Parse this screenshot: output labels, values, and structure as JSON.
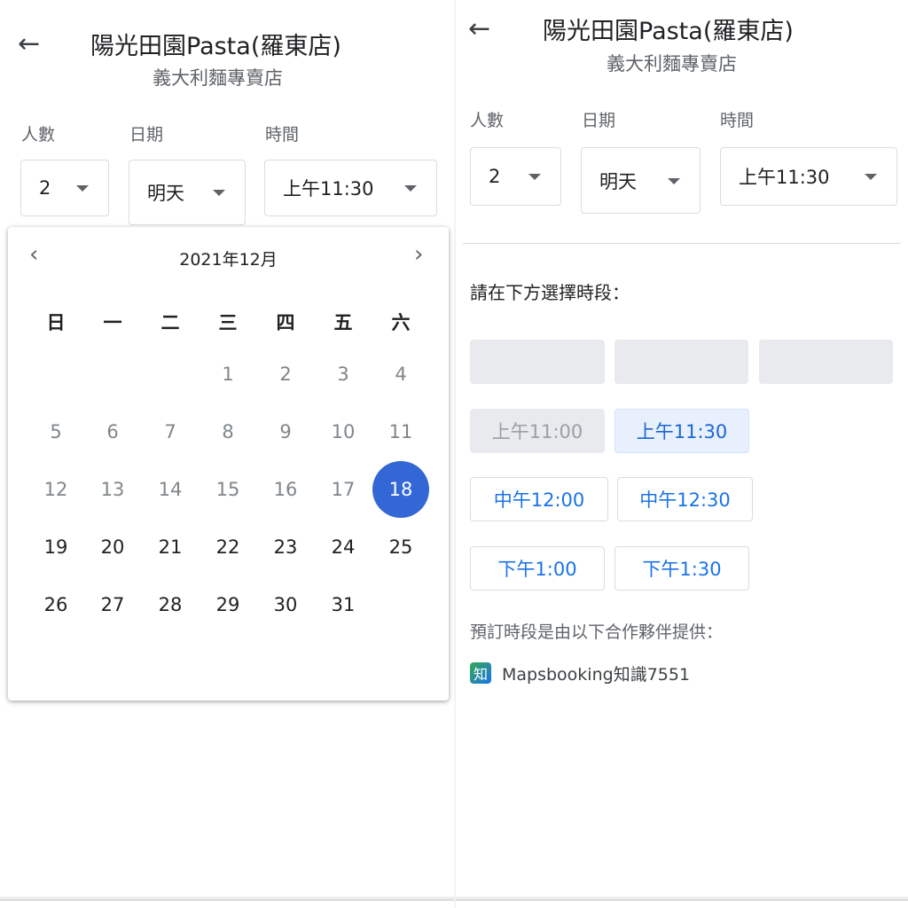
{
  "left": {
    "title": "陽光田園Pasta(羅東店)",
    "subtitle": "義大利麵專賣店",
    "back_icon": "←",
    "fields": {
      "party_label": "人數",
      "party_value": "2",
      "date_label": "日期",
      "date_value": "明天",
      "time_label": "時間",
      "time_value": "上午11:30"
    },
    "calendar": {
      "month_label": "2021年12月",
      "prev_icon": "‹",
      "next_icon": "›",
      "weekdays": [
        "日",
        "一",
        "二",
        "三",
        "四",
        "五",
        "六"
      ],
      "days": [
        "1",
        "2",
        "3",
        "4",
        "5",
        "6",
        "7",
        "8",
        "9",
        "10",
        "11",
        "12",
        "13",
        "14",
        "15",
        "16",
        "17",
        "18",
        "19",
        "20",
        "21",
        "22",
        "23",
        "24",
        "25",
        "26",
        "27",
        "28",
        "29",
        "30",
        "31"
      ],
      "selected_day": "18",
      "selected_color": "#3367d6"
    }
  },
  "right": {
    "title": "陽光田園Pasta(羅東店)",
    "subtitle": "義大利麵專賣店",
    "back_icon": "←",
    "fields": {
      "party_label": "人數",
      "party_value": "2",
      "date_label": "日期",
      "date_value": "明天",
      "time_label": "時間",
      "time_value": "上午11:30"
    },
    "prompt": "請在下方選擇時段：",
    "slots": {
      "s1100": "上午11:00",
      "s1130": "上午11:30",
      "s1200": "中午12:00",
      "s1230": "中午12:30",
      "s1300": "下午1:00",
      "s1330": "下午1:30"
    },
    "provider_note": "預訂時段是由以下合作夥伴提供：",
    "provider_logo": "知",
    "provider_name": "Mapsbooking知識7551",
    "accent_color": "#1a73e8"
  }
}
